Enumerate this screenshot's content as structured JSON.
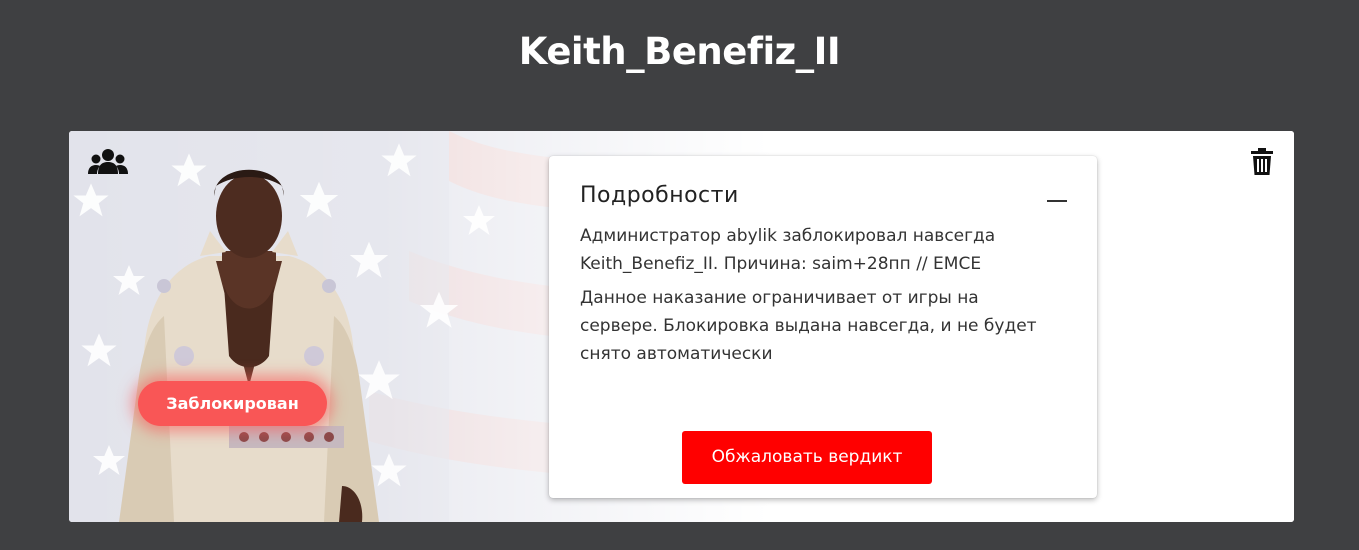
{
  "page": {
    "title": "Keith_Benefiz_II"
  },
  "card": {
    "status_badge": "Заблокирован",
    "status_color": "#f95656",
    "left_icon": "group-icon",
    "right_icon": "trash-icon"
  },
  "details": {
    "title": "Подробности",
    "collapse_icon": "minus-icon",
    "paragraph_1": "Администратор abylik заблокировал навсегда Keith_Benefiz_II. Причина: saim+28пп // EMCE",
    "paragraph_2": "Данное наказание ограничивает от игры на сервере. Блокировка выдана навсегда, и не будет снято автоматически",
    "appeal_button": "Обжаловать вердикт",
    "appeal_button_color": "#ff0000"
  }
}
